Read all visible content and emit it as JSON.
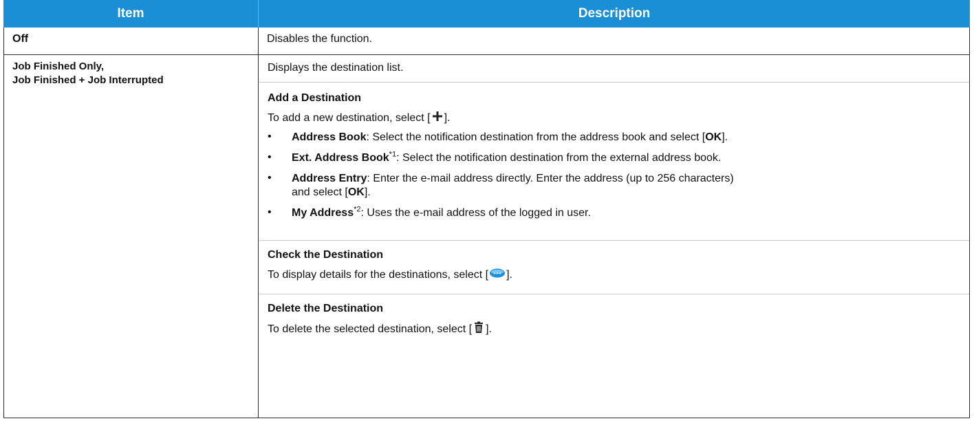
{
  "headers": {
    "item": "Item",
    "description": "Description"
  },
  "rows": {
    "off": {
      "item": "Off",
      "desc": "Disables the function."
    },
    "job": {
      "item_line1": "Job Finished Only,",
      "item_line2": "Job Finished + Job Interrupted",
      "desc_intro": "Displays the destination list.",
      "add": {
        "title": "Add a Destination",
        "intro_pre": "To add a new destination, select [",
        "intro_post": "].",
        "bullets": {
          "address_book": {
            "term": "Address Book",
            "text_pre": ": Select the notification destination from the address book and select [",
            "ok": "OK",
            "text_post": "]."
          },
          "ext_address_book": {
            "term": "Ext. Address Book",
            "sup": "*1",
            "text": ": Select the notification destination from the external address book."
          },
          "address_entry": {
            "term": "Address Entry",
            "text_pre": ": Enter the e-mail address directly. Enter the address (up to 256 characters)",
            "text2_pre": "and select [",
            "ok": "OK",
            "text2_post": "]."
          },
          "my_address": {
            "term": "My Address",
            "sup": "*2",
            "text": ": Uses the e-mail address of the logged in user."
          }
        }
      },
      "check": {
        "title": "Check the Destination",
        "text_pre": "To display details for the destinations, select [",
        "text_post": "]."
      },
      "delete": {
        "title": "Delete the Destination",
        "text_pre": "To delete the selected destination, select [",
        "text_post": "]."
      }
    }
  },
  "icons": {
    "add": "plus-icon",
    "details": "details-oval-icon",
    "delete": "trash-icon"
  },
  "colors": {
    "header_bg": "#1a8fd6",
    "header_text": "#ffffff",
    "border": "#2b2b2b",
    "divider": "#c9c9c9",
    "icon_blue": "#1d8fe0"
  }
}
